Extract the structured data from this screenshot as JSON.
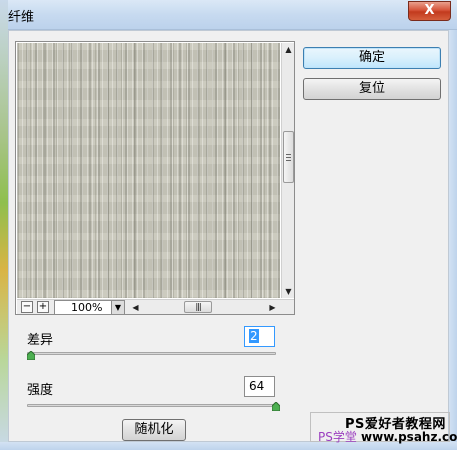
{
  "window": {
    "title": "纤维",
    "close_label": "X"
  },
  "buttons": {
    "ok_label": "确定",
    "reset_label": "复位",
    "randomize_label": "随机化"
  },
  "preview": {
    "zoom_out_label": "−",
    "zoom_in_label": "+",
    "zoom_value": "100%"
  },
  "params": {
    "variance": {
      "label": "差异",
      "value": "2",
      "min": 1,
      "max": 64
    },
    "strength": {
      "label": "强度",
      "value": "64",
      "min": 1,
      "max": 64
    }
  },
  "watermark": {
    "line1": "PS爱好者教程网",
    "line2_prefix": "PS学堂",
    "line2_url": "www.psahz.com"
  }
}
